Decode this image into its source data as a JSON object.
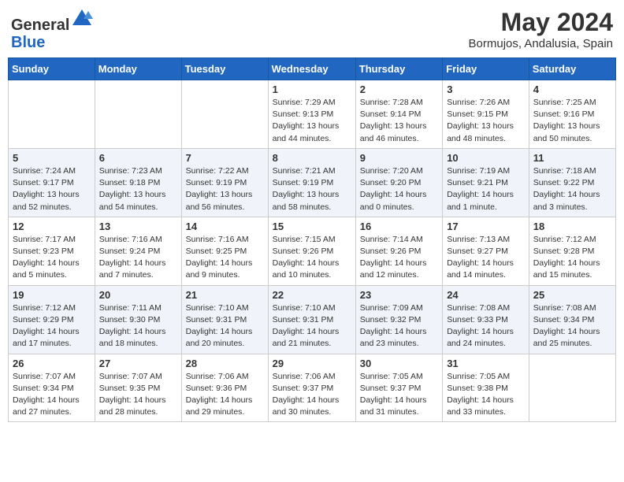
{
  "header": {
    "logo_line1": "General",
    "logo_line2": "Blue",
    "month_year": "May 2024",
    "location": "Bormujos, Andalusia, Spain"
  },
  "days_of_week": [
    "Sunday",
    "Monday",
    "Tuesday",
    "Wednesday",
    "Thursday",
    "Friday",
    "Saturday"
  ],
  "weeks": [
    [
      {
        "day": "",
        "info": ""
      },
      {
        "day": "",
        "info": ""
      },
      {
        "day": "",
        "info": ""
      },
      {
        "day": "1",
        "info": "Sunrise: 7:29 AM\nSunset: 9:13 PM\nDaylight: 13 hours\nand 44 minutes."
      },
      {
        "day": "2",
        "info": "Sunrise: 7:28 AM\nSunset: 9:14 PM\nDaylight: 13 hours\nand 46 minutes."
      },
      {
        "day": "3",
        "info": "Sunrise: 7:26 AM\nSunset: 9:15 PM\nDaylight: 13 hours\nand 48 minutes."
      },
      {
        "day": "4",
        "info": "Sunrise: 7:25 AM\nSunset: 9:16 PM\nDaylight: 13 hours\nand 50 minutes."
      }
    ],
    [
      {
        "day": "5",
        "info": "Sunrise: 7:24 AM\nSunset: 9:17 PM\nDaylight: 13 hours\nand 52 minutes."
      },
      {
        "day": "6",
        "info": "Sunrise: 7:23 AM\nSunset: 9:18 PM\nDaylight: 13 hours\nand 54 minutes."
      },
      {
        "day": "7",
        "info": "Sunrise: 7:22 AM\nSunset: 9:19 PM\nDaylight: 13 hours\nand 56 minutes."
      },
      {
        "day": "8",
        "info": "Sunrise: 7:21 AM\nSunset: 9:19 PM\nDaylight: 13 hours\nand 58 minutes."
      },
      {
        "day": "9",
        "info": "Sunrise: 7:20 AM\nSunset: 9:20 PM\nDaylight: 14 hours\nand 0 minutes."
      },
      {
        "day": "10",
        "info": "Sunrise: 7:19 AM\nSunset: 9:21 PM\nDaylight: 14 hours\nand 1 minute."
      },
      {
        "day": "11",
        "info": "Sunrise: 7:18 AM\nSunset: 9:22 PM\nDaylight: 14 hours\nand 3 minutes."
      }
    ],
    [
      {
        "day": "12",
        "info": "Sunrise: 7:17 AM\nSunset: 9:23 PM\nDaylight: 14 hours\nand 5 minutes."
      },
      {
        "day": "13",
        "info": "Sunrise: 7:16 AM\nSunset: 9:24 PM\nDaylight: 14 hours\nand 7 minutes."
      },
      {
        "day": "14",
        "info": "Sunrise: 7:16 AM\nSunset: 9:25 PM\nDaylight: 14 hours\nand 9 minutes."
      },
      {
        "day": "15",
        "info": "Sunrise: 7:15 AM\nSunset: 9:26 PM\nDaylight: 14 hours\nand 10 minutes."
      },
      {
        "day": "16",
        "info": "Sunrise: 7:14 AM\nSunset: 9:26 PM\nDaylight: 14 hours\nand 12 minutes."
      },
      {
        "day": "17",
        "info": "Sunrise: 7:13 AM\nSunset: 9:27 PM\nDaylight: 14 hours\nand 14 minutes."
      },
      {
        "day": "18",
        "info": "Sunrise: 7:12 AM\nSunset: 9:28 PM\nDaylight: 14 hours\nand 15 minutes."
      }
    ],
    [
      {
        "day": "19",
        "info": "Sunrise: 7:12 AM\nSunset: 9:29 PM\nDaylight: 14 hours\nand 17 minutes."
      },
      {
        "day": "20",
        "info": "Sunrise: 7:11 AM\nSunset: 9:30 PM\nDaylight: 14 hours\nand 18 minutes."
      },
      {
        "day": "21",
        "info": "Sunrise: 7:10 AM\nSunset: 9:31 PM\nDaylight: 14 hours\nand 20 minutes."
      },
      {
        "day": "22",
        "info": "Sunrise: 7:10 AM\nSunset: 9:31 PM\nDaylight: 14 hours\nand 21 minutes."
      },
      {
        "day": "23",
        "info": "Sunrise: 7:09 AM\nSunset: 9:32 PM\nDaylight: 14 hours\nand 23 minutes."
      },
      {
        "day": "24",
        "info": "Sunrise: 7:08 AM\nSunset: 9:33 PM\nDaylight: 14 hours\nand 24 minutes."
      },
      {
        "day": "25",
        "info": "Sunrise: 7:08 AM\nSunset: 9:34 PM\nDaylight: 14 hours\nand 25 minutes."
      }
    ],
    [
      {
        "day": "26",
        "info": "Sunrise: 7:07 AM\nSunset: 9:34 PM\nDaylight: 14 hours\nand 27 minutes."
      },
      {
        "day": "27",
        "info": "Sunrise: 7:07 AM\nSunset: 9:35 PM\nDaylight: 14 hours\nand 28 minutes."
      },
      {
        "day": "28",
        "info": "Sunrise: 7:06 AM\nSunset: 9:36 PM\nDaylight: 14 hours\nand 29 minutes."
      },
      {
        "day": "29",
        "info": "Sunrise: 7:06 AM\nSunset: 9:37 PM\nDaylight: 14 hours\nand 30 minutes."
      },
      {
        "day": "30",
        "info": "Sunrise: 7:05 AM\nSunset: 9:37 PM\nDaylight: 14 hours\nand 31 minutes."
      },
      {
        "day": "31",
        "info": "Sunrise: 7:05 AM\nSunset: 9:38 PM\nDaylight: 14 hours\nand 33 minutes."
      },
      {
        "day": "",
        "info": ""
      }
    ]
  ]
}
